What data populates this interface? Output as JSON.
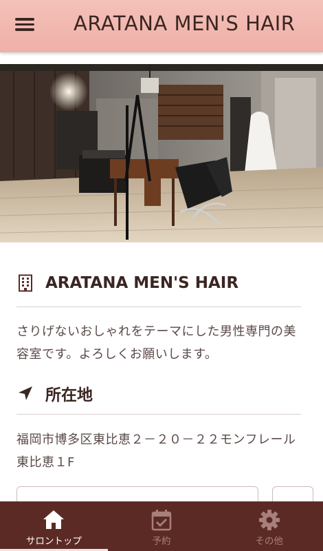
{
  "header": {
    "title": "ARATANA MEN'S HAIR",
    "menu_icon": "hamburger-menu-icon"
  },
  "hero": {
    "image": "salon-interior-photo"
  },
  "salon_section": {
    "icon": "building-icon",
    "heading": "ARATANA MEN'S HAIR",
    "description": "さりげないおしゃれをテーマにした男性専門の美容室です。よろしくお願いします。"
  },
  "location_section": {
    "icon": "location-arrow-icon",
    "heading": "所在地",
    "address": "福岡市博多区東比恵２－２０－２２モンフレール東比恵１F"
  },
  "tabbar": {
    "tabs": [
      {
        "label": "サロントップ",
        "icon": "home-icon",
        "active": true
      },
      {
        "label": "予約",
        "icon": "calendar-check-icon",
        "active": false
      },
      {
        "label": "その他",
        "icon": "gear-icon",
        "active": false
      }
    ]
  },
  "colors": {
    "header_bg": "#f1b8b0",
    "text": "#3a2622",
    "tabbar_bg": "#5c2a25",
    "tab_inactive": "#a8807b"
  }
}
